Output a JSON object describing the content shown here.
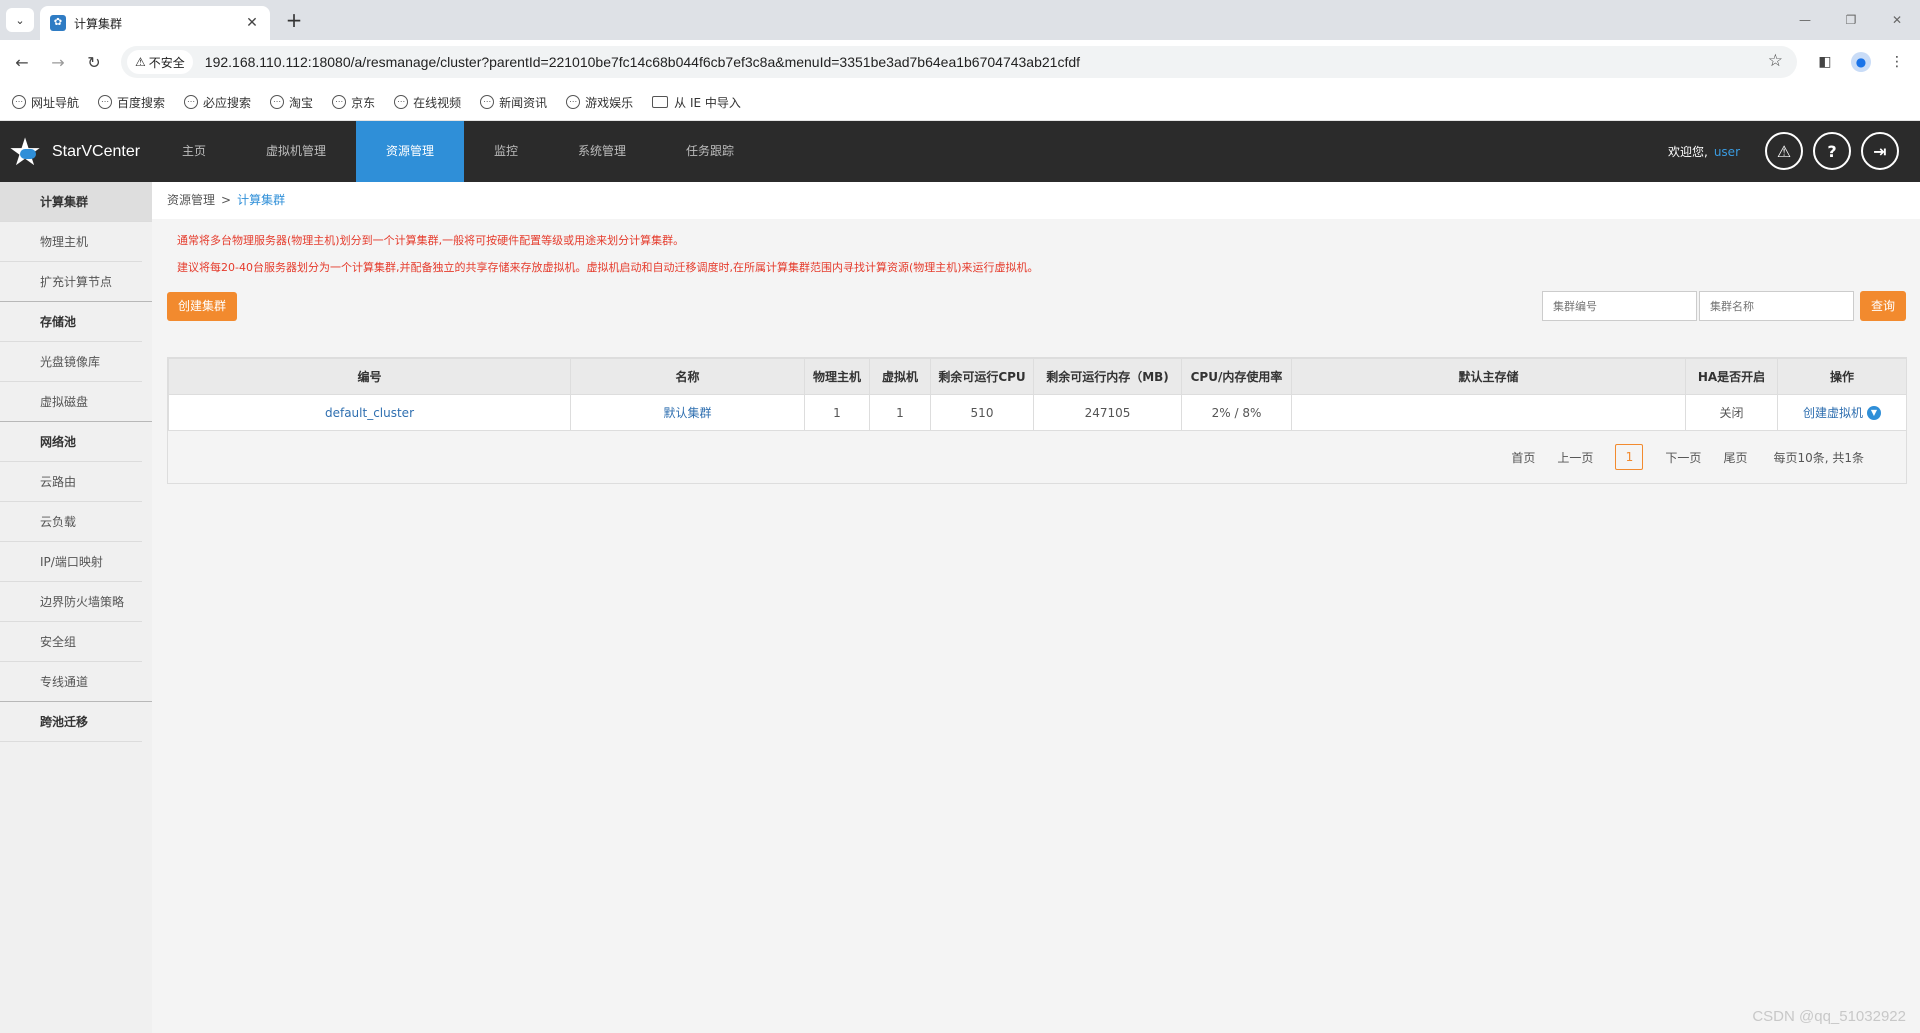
{
  "browser": {
    "tab_title": "计算集群",
    "security_label": "不安全",
    "url": "192.168.110.112:18080/a/resmanage/cluster?parentId=221010be7fc14c68b044f6cb7ef3c8a&menuId=3351be3ad7b64ea1b6704743ab21cfdf",
    "bookmarks": [
      "网址导航",
      "百度搜索",
      "必应搜索",
      "淘宝",
      "京东",
      "在线视频",
      "新闻资讯",
      "游戏娱乐"
    ],
    "bookmark_folder": "从 IE 中导入"
  },
  "header": {
    "logo_text": "StarVCenter",
    "nav": [
      "主页",
      "虚拟机管理",
      "资源管理",
      "监控",
      "系统管理",
      "任务跟踪"
    ],
    "active_nav": "资源管理",
    "welcome_label": "欢迎您,",
    "username": "user",
    "icons": [
      "alert-icon",
      "help-icon",
      "logout-icon"
    ]
  },
  "sidebar": {
    "items": [
      {
        "label": "计算集群",
        "group": true,
        "active": true
      },
      {
        "label": "物理主机",
        "group": false
      },
      {
        "label": "扩充计算节点",
        "group": false
      },
      {
        "label": "存储池",
        "group": true
      },
      {
        "label": "光盘镜像库",
        "group": false
      },
      {
        "label": "虚拟磁盘",
        "group": false
      },
      {
        "label": "网络池",
        "group": true
      },
      {
        "label": "云路由",
        "group": false
      },
      {
        "label": "云负载",
        "group": false
      },
      {
        "label": "IP/端口映射",
        "group": false
      },
      {
        "label": "边界防火墙策略",
        "group": false
      },
      {
        "label": "安全组",
        "group": false
      },
      {
        "label": "专线通道",
        "group": false
      },
      {
        "label": "跨池迁移",
        "group": true
      }
    ]
  },
  "breadcrumb": {
    "parent": "资源管理",
    "separator": ">",
    "current": "计算集群"
  },
  "notice": [
    "通常将多台物理服务器(物理主机)划分到一个计算集群,一般将可按硬件配置等级或用途来划分计算集群。",
    "建议将每20-40台服务器划分为一个计算集群,并配备独立的共享存储来存放虚拟机。虚拟机启动和自动迁移调度时,在所属计算集群范围内寻找计算资源(物理主机)来运行虚拟机。"
  ],
  "actions": {
    "create_label": "创建集群",
    "cluster_id_placeholder": "集群编号",
    "cluster_name_placeholder": "集群名称",
    "query_label": "查询"
  },
  "table": {
    "columns": [
      "编号",
      "名称",
      "物理主机",
      "虚拟机",
      "剩余可运行CPU",
      "剩余可运行内存（MB)",
      "CPU/内存使用率",
      "默认主存储",
      "HA是否开启",
      "操作"
    ],
    "rows": [
      {
        "id": "default_cluster",
        "name": "默认集群",
        "hosts": "1",
        "vms": "1",
        "cpu": "510",
        "mem": "247105",
        "usage": "2% / 8%",
        "storage": "",
        "ha": "关闭",
        "op": "创建虚拟机"
      }
    ]
  },
  "pager": {
    "first": "首页",
    "prev": "上一页",
    "page": "1",
    "next": "下一页",
    "last": "尾页",
    "summary": "每页10条, 共1条"
  },
  "watermark": "CSDN @qq_51032922",
  "colors": {
    "accent": "#2f8fd8",
    "orange": "#f28a2e",
    "notice": "#e53b2c",
    "header_bg": "#2b2b2b"
  }
}
